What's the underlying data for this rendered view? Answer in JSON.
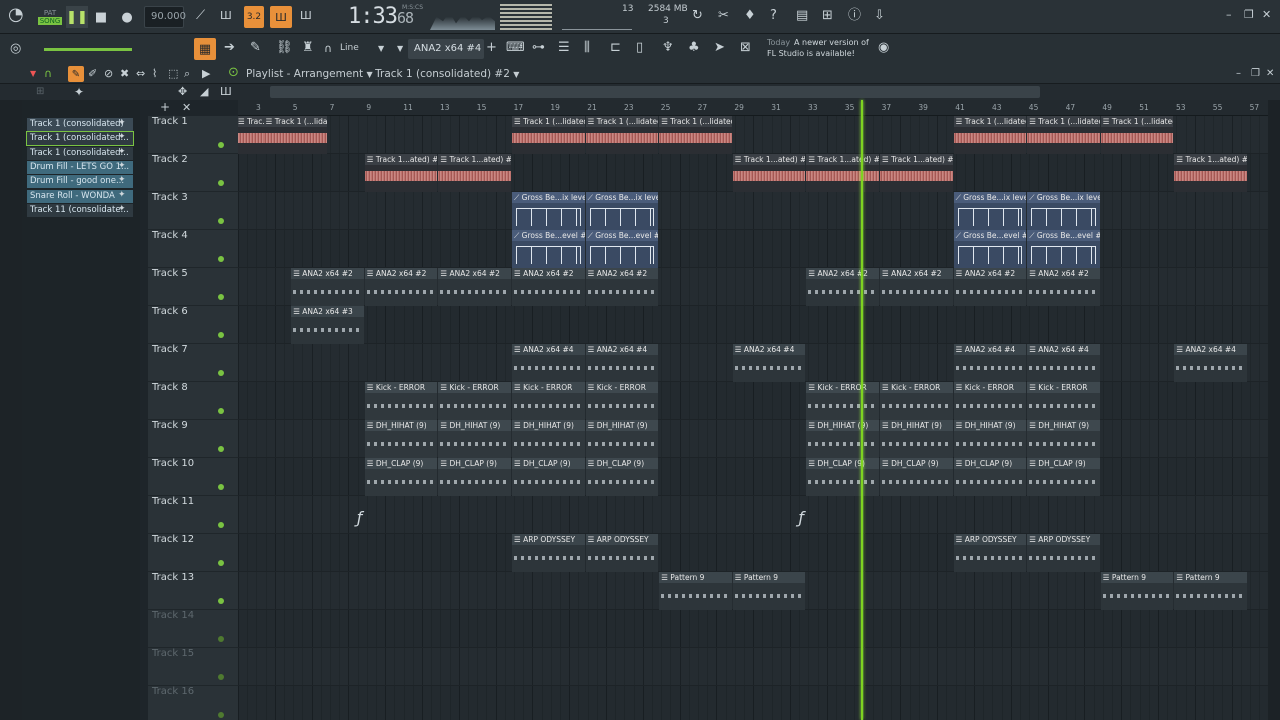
{
  "transport": {
    "mode_label": "SONG",
    "tempo": "90.000",
    "time": "1:33",
    "time_ms": "68",
    "time_unit": "M:S:CS",
    "memory": "2584 MB",
    "cpu": "13",
    "voices": "3"
  },
  "toolbar": {
    "snap_label": "Line",
    "pattern_label": "ANA2 x64 #4",
    "news_date": "Today",
    "news_text1": "A newer version of",
    "news_text2": "FL Studio is available!"
  },
  "playlist": {
    "title": "Playlist - Arrangement",
    "separator": "›",
    "track_title": "Track 1 (consolidated) #2"
  },
  "picker": [
    "Track 1 (consolidated)",
    "Track 1 (consolidated...",
    "Track 1 (consolidated...",
    "Drum Fill - LETS GO 1...",
    "Drum Fill - good one...",
    "Snare Roll - WONDA",
    "Track 11 (consolidate..."
  ],
  "ruler": [
    "3",
    "5",
    "7",
    "9",
    "11",
    "13",
    "15",
    "17",
    "19",
    "21",
    "23",
    "25",
    "27",
    "29",
    "31",
    "33",
    "35",
    "37",
    "39",
    "41",
    "43",
    "45",
    "47",
    "49",
    "51",
    "53",
    "55",
    "57"
  ],
  "tracks": [
    "Track 1",
    "Track 2",
    "Track 3",
    "Track 4",
    "Track 5",
    "Track 6",
    "Track 7",
    "Track 8",
    "Track 9",
    "Track 10",
    "Track 11",
    "Track 12",
    "Track 13",
    "Track 14",
    "Track 15",
    "Track 16"
  ],
  "clips": {
    "c1a": "Trac...ated)",
    "c1b": "Track 1 (...lidated)",
    "c1c": "Track 1 (...lidated)",
    "c1d": "Track 1 (...lidated)",
    "c1e": "Track 1 (...lidated)",
    "c1f": "Track 1 (...lidated)",
    "c1g": "Track 1 (...lidated)",
    "c1h": "Track 1 (...lidated)",
    "c2a": "Track 1...ated) #2",
    "c2b": "Track 1...ated) #2",
    "c2c": "Track 1...ated) #2",
    "c2d": "Track 1...ated) #2",
    "c2e": "Track 1...ated) #2",
    "c2f": "Track 1...ated) #2",
    "c3a": "Gross Be...ix level",
    "c3b": "Gross Be...ix level",
    "c3c": "Gross Be...ix level",
    "c3d": "Gross Be...ix level",
    "c4a": "Gross Be...evel #2",
    "c4b": "Gross Be...evel #2",
    "c4c": "Gross Be...evel #2",
    "c4d": "Gross Be...evel #2",
    "c5": "ANA2 x64 #2",
    "c6": "ANA2 x64 #3",
    "c7": "ANA2 x64 #4",
    "c8": "Kick - ERROR",
    "c9": "DH_HIHAT (9)",
    "c10": "DH_CLAP (9)",
    "c12": "ARP ODYSSEY",
    "c13": "Pattern 9"
  }
}
